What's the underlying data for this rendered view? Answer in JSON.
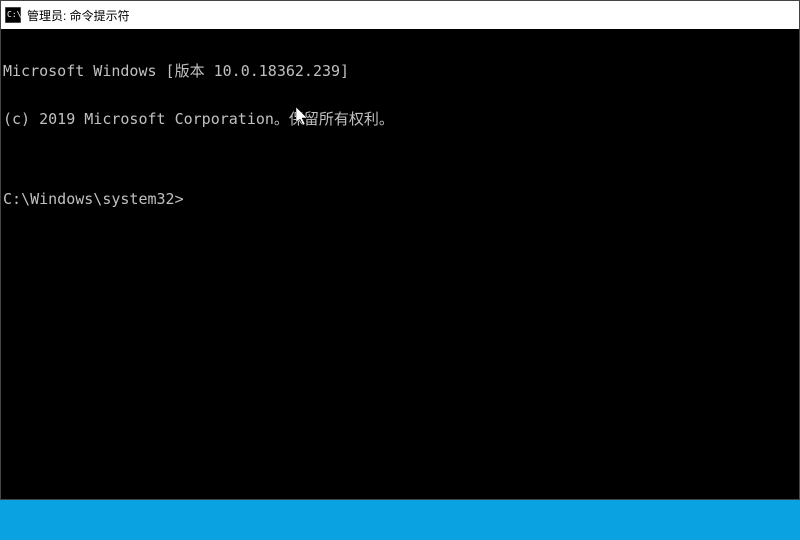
{
  "titlebar": {
    "title": "管理员: 命令提示符"
  },
  "terminal": {
    "line1": "Microsoft Windows [版本 10.0.18362.239]",
    "line2": "(c) 2019 Microsoft Corporation。保留所有权利。",
    "blank": "",
    "prompt": "C:\\Windows\\system32>",
    "input": ""
  }
}
